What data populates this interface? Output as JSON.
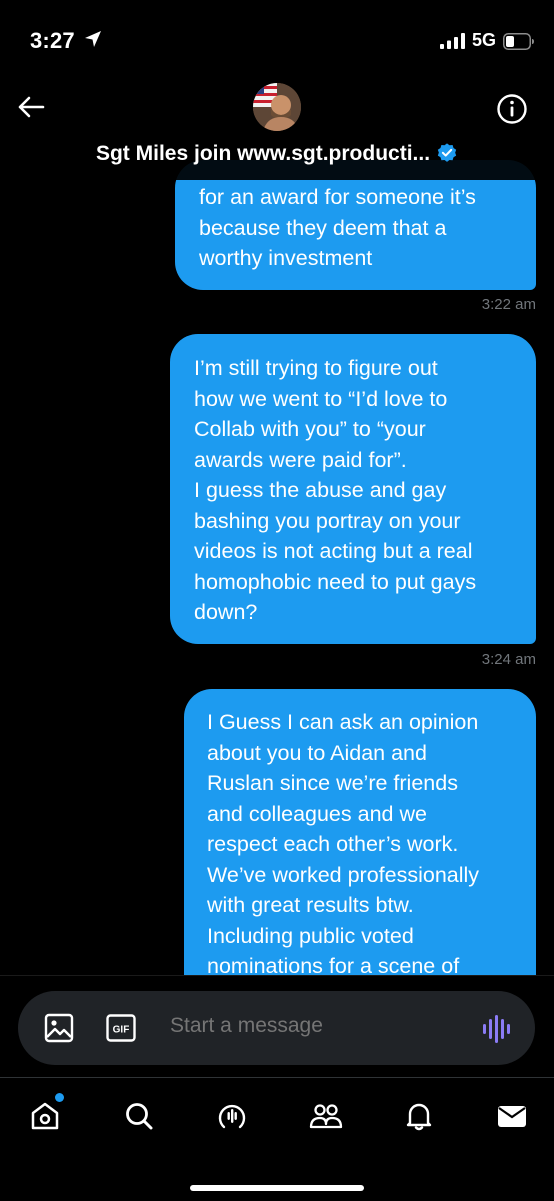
{
  "status_bar": {
    "time": "3:27",
    "network": "5G"
  },
  "header": {
    "contact_name": "Sgt Miles join www.sgt.producti..."
  },
  "messages": [
    {
      "lines": [
        "for an award for someone it’s",
        "because they deem that a",
        "worthy investment"
      ],
      "time": "3:22 am"
    },
    {
      "lines": [
        "I’m still trying to figure out",
        "how we went to “I’d love to",
        "Collab with you” to “your",
        "awards were paid for”.",
        "I guess the abuse and gay",
        "bashing you portray on your",
        "videos is not acting but a real",
        "homophobic need to put gays",
        "down?"
      ],
      "time": "3:24 am"
    },
    {
      "lines": [
        "I Guess I can ask an opinion",
        "about you to Aidan and",
        "Ruslan since we’re friends",
        "and colleagues and we",
        "respect each other’s work.",
        "We’ve worked professionally",
        "with great results btw.",
        "Including public voted",
        "nominations for a scene of"
      ]
    }
  ],
  "composer": {
    "placeholder": "Start a message",
    "gif_label": "GIF"
  },
  "tabs": [
    "home",
    "search",
    "spaces",
    "communities",
    "notifications",
    "messages"
  ],
  "colors": {
    "accent": "#1d9bf0",
    "background": "#000000",
    "muted": "#71767b",
    "voice": "#8b7cf6"
  },
  "icons": [
    "location-arrow-icon",
    "signal-icon",
    "battery-icon",
    "back-arrow-icon",
    "info-icon",
    "verified-badge-icon",
    "image-icon",
    "gif-icon",
    "voice-icon",
    "home-icon",
    "search-icon",
    "spaces-icon",
    "communities-icon",
    "bell-icon",
    "mail-icon"
  ]
}
